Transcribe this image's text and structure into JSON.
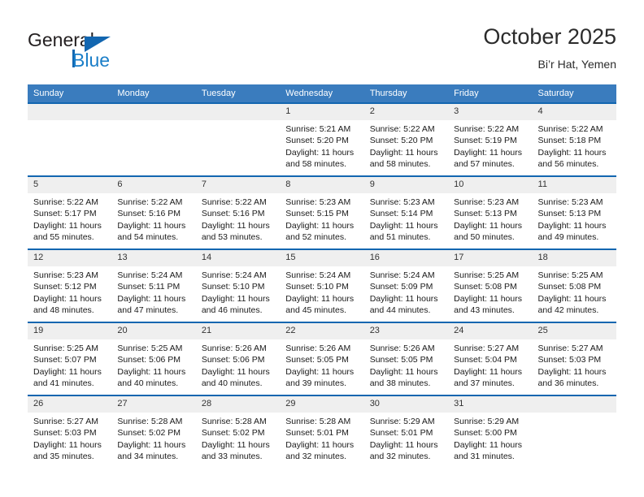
{
  "brand": {
    "name_part1": "General",
    "name_part2": "Blue",
    "logo_icon": "blue-triangle-flag-icon",
    "accent_color": "#1266b0",
    "light_blue": "#1a7ec8"
  },
  "header": {
    "title": "October 2025",
    "subtitle": "Bi’r Hat, Yemen"
  },
  "calendar": {
    "header_bg": "#3a7cbe",
    "row_border_color": "#1266b0",
    "daynum_bg": "#efefef",
    "weekdays": [
      "Sunday",
      "Monday",
      "Tuesday",
      "Wednesday",
      "Thursday",
      "Friday",
      "Saturday"
    ],
    "weeks": [
      [
        {
          "day": "",
          "empty": true,
          "lines": []
        },
        {
          "day": "",
          "empty": true,
          "lines": []
        },
        {
          "day": "",
          "empty": true,
          "lines": []
        },
        {
          "day": "1",
          "empty": false,
          "lines": [
            "Sunrise: 5:21 AM",
            "Sunset: 5:20 PM",
            "Daylight: 11 hours",
            "and 58 minutes."
          ]
        },
        {
          "day": "2",
          "empty": false,
          "lines": [
            "Sunrise: 5:22 AM",
            "Sunset: 5:20 PM",
            "Daylight: 11 hours",
            "and 58 minutes."
          ]
        },
        {
          "day": "3",
          "empty": false,
          "lines": [
            "Sunrise: 5:22 AM",
            "Sunset: 5:19 PM",
            "Daylight: 11 hours",
            "and 57 minutes."
          ]
        },
        {
          "day": "4",
          "empty": false,
          "lines": [
            "Sunrise: 5:22 AM",
            "Sunset: 5:18 PM",
            "Daylight: 11 hours",
            "and 56 minutes."
          ]
        }
      ],
      [
        {
          "day": "5",
          "empty": false,
          "lines": [
            "Sunrise: 5:22 AM",
            "Sunset: 5:17 PM",
            "Daylight: 11 hours",
            "and 55 minutes."
          ]
        },
        {
          "day": "6",
          "empty": false,
          "lines": [
            "Sunrise: 5:22 AM",
            "Sunset: 5:16 PM",
            "Daylight: 11 hours",
            "and 54 minutes."
          ]
        },
        {
          "day": "7",
          "empty": false,
          "lines": [
            "Sunrise: 5:22 AM",
            "Sunset: 5:16 PM",
            "Daylight: 11 hours",
            "and 53 minutes."
          ]
        },
        {
          "day": "8",
          "empty": false,
          "lines": [
            "Sunrise: 5:23 AM",
            "Sunset: 5:15 PM",
            "Daylight: 11 hours",
            "and 52 minutes."
          ]
        },
        {
          "day": "9",
          "empty": false,
          "lines": [
            "Sunrise: 5:23 AM",
            "Sunset: 5:14 PM",
            "Daylight: 11 hours",
            "and 51 minutes."
          ]
        },
        {
          "day": "10",
          "empty": false,
          "lines": [
            "Sunrise: 5:23 AM",
            "Sunset: 5:13 PM",
            "Daylight: 11 hours",
            "and 50 minutes."
          ]
        },
        {
          "day": "11",
          "empty": false,
          "lines": [
            "Sunrise: 5:23 AM",
            "Sunset: 5:13 PM",
            "Daylight: 11 hours",
            "and 49 minutes."
          ]
        }
      ],
      [
        {
          "day": "12",
          "empty": false,
          "lines": [
            "Sunrise: 5:23 AM",
            "Sunset: 5:12 PM",
            "Daylight: 11 hours",
            "and 48 minutes."
          ]
        },
        {
          "day": "13",
          "empty": false,
          "lines": [
            "Sunrise: 5:24 AM",
            "Sunset: 5:11 PM",
            "Daylight: 11 hours",
            "and 47 minutes."
          ]
        },
        {
          "day": "14",
          "empty": false,
          "lines": [
            "Sunrise: 5:24 AM",
            "Sunset: 5:10 PM",
            "Daylight: 11 hours",
            "and 46 minutes."
          ]
        },
        {
          "day": "15",
          "empty": false,
          "lines": [
            "Sunrise: 5:24 AM",
            "Sunset: 5:10 PM",
            "Daylight: 11 hours",
            "and 45 minutes."
          ]
        },
        {
          "day": "16",
          "empty": false,
          "lines": [
            "Sunrise: 5:24 AM",
            "Sunset: 5:09 PM",
            "Daylight: 11 hours",
            "and 44 minutes."
          ]
        },
        {
          "day": "17",
          "empty": false,
          "lines": [
            "Sunrise: 5:25 AM",
            "Sunset: 5:08 PM",
            "Daylight: 11 hours",
            "and 43 minutes."
          ]
        },
        {
          "day": "18",
          "empty": false,
          "lines": [
            "Sunrise: 5:25 AM",
            "Sunset: 5:08 PM",
            "Daylight: 11 hours",
            "and 42 minutes."
          ]
        }
      ],
      [
        {
          "day": "19",
          "empty": false,
          "lines": [
            "Sunrise: 5:25 AM",
            "Sunset: 5:07 PM",
            "Daylight: 11 hours",
            "and 41 minutes."
          ]
        },
        {
          "day": "20",
          "empty": false,
          "lines": [
            "Sunrise: 5:25 AM",
            "Sunset: 5:06 PM",
            "Daylight: 11 hours",
            "and 40 minutes."
          ]
        },
        {
          "day": "21",
          "empty": false,
          "lines": [
            "Sunrise: 5:26 AM",
            "Sunset: 5:06 PM",
            "Daylight: 11 hours",
            "and 40 minutes."
          ]
        },
        {
          "day": "22",
          "empty": false,
          "lines": [
            "Sunrise: 5:26 AM",
            "Sunset: 5:05 PM",
            "Daylight: 11 hours",
            "and 39 minutes."
          ]
        },
        {
          "day": "23",
          "empty": false,
          "lines": [
            "Sunrise: 5:26 AM",
            "Sunset: 5:05 PM",
            "Daylight: 11 hours",
            "and 38 minutes."
          ]
        },
        {
          "day": "24",
          "empty": false,
          "lines": [
            "Sunrise: 5:27 AM",
            "Sunset: 5:04 PM",
            "Daylight: 11 hours",
            "and 37 minutes."
          ]
        },
        {
          "day": "25",
          "empty": false,
          "lines": [
            "Sunrise: 5:27 AM",
            "Sunset: 5:03 PM",
            "Daylight: 11 hours",
            "and 36 minutes."
          ]
        }
      ],
      [
        {
          "day": "26",
          "empty": false,
          "lines": [
            "Sunrise: 5:27 AM",
            "Sunset: 5:03 PM",
            "Daylight: 11 hours",
            "and 35 minutes."
          ]
        },
        {
          "day": "27",
          "empty": false,
          "lines": [
            "Sunrise: 5:28 AM",
            "Sunset: 5:02 PM",
            "Daylight: 11 hours",
            "and 34 minutes."
          ]
        },
        {
          "day": "28",
          "empty": false,
          "lines": [
            "Sunrise: 5:28 AM",
            "Sunset: 5:02 PM",
            "Daylight: 11 hours",
            "and 33 minutes."
          ]
        },
        {
          "day": "29",
          "empty": false,
          "lines": [
            "Sunrise: 5:28 AM",
            "Sunset: 5:01 PM",
            "Daylight: 11 hours",
            "and 32 minutes."
          ]
        },
        {
          "day": "30",
          "empty": false,
          "lines": [
            "Sunrise: 5:29 AM",
            "Sunset: 5:01 PM",
            "Daylight: 11 hours",
            "and 32 minutes."
          ]
        },
        {
          "day": "31",
          "empty": false,
          "lines": [
            "Sunrise: 5:29 AM",
            "Sunset: 5:00 PM",
            "Daylight: 11 hours",
            "and 31 minutes."
          ]
        },
        {
          "day": "",
          "empty": true,
          "lines": []
        }
      ]
    ]
  }
}
